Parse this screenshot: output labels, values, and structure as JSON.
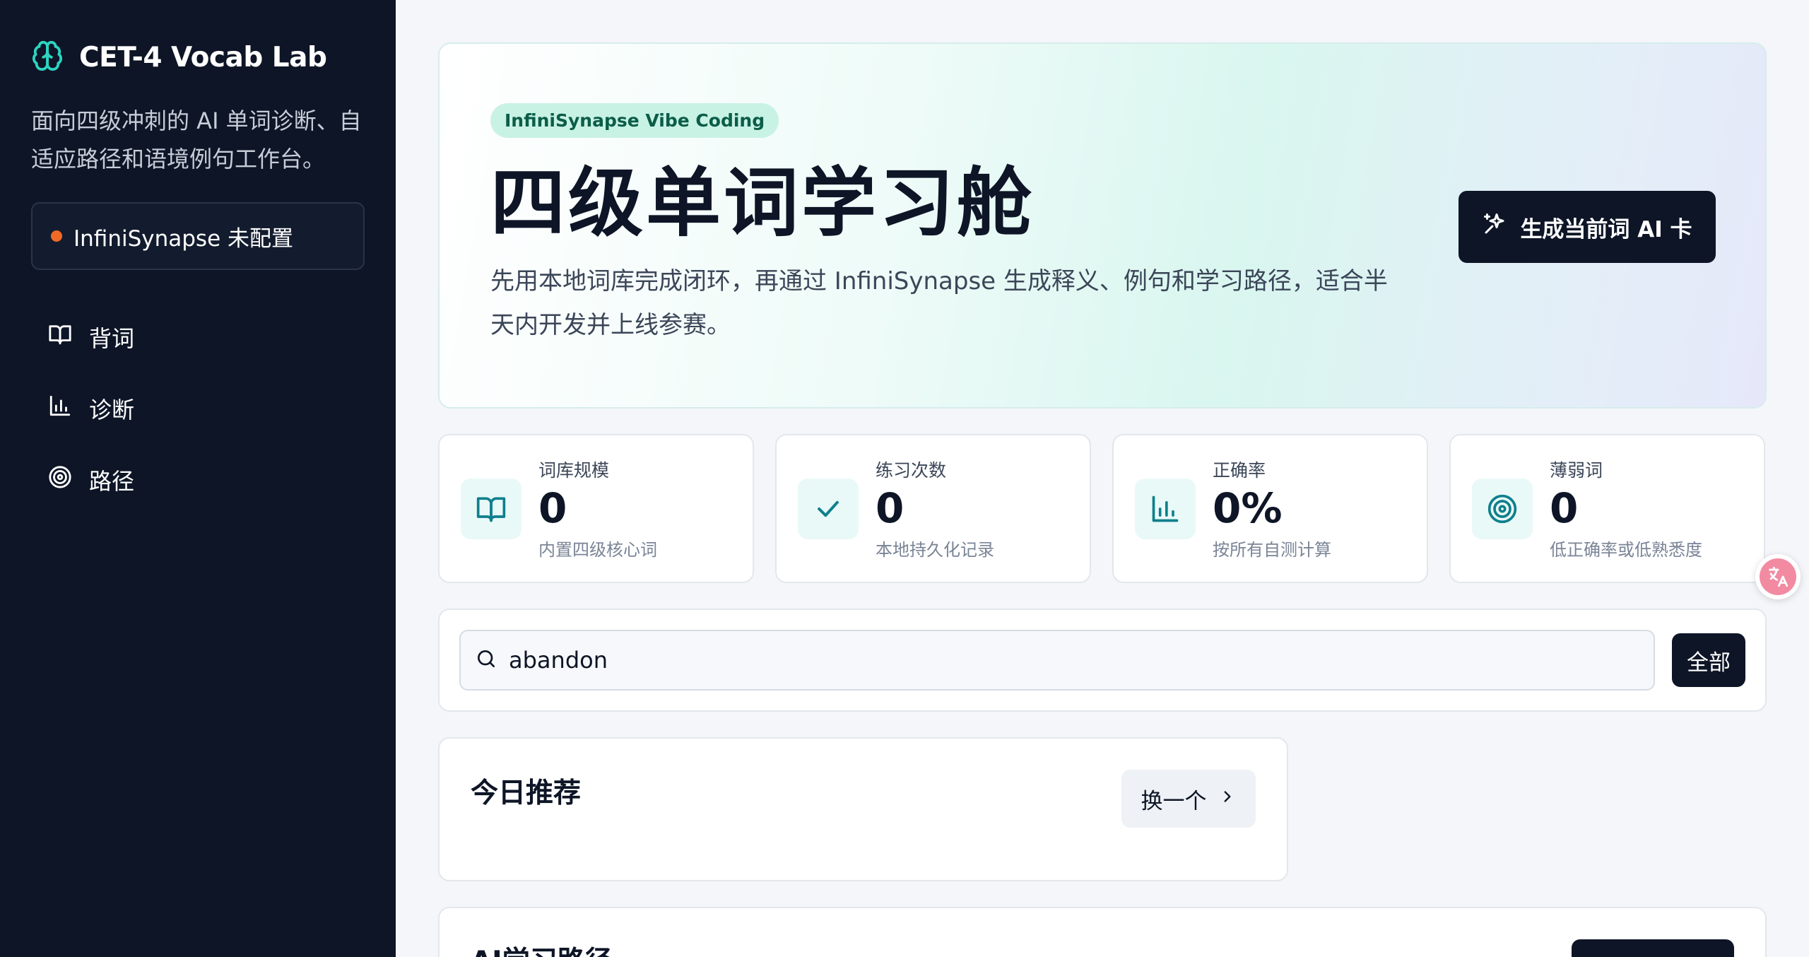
{
  "sidebar": {
    "brand_title": "CET-4 Vocab Lab",
    "brand_desc": "面向四级冲刺的 AI 单词诊断、自适应路径和语境例句工作台。",
    "status_text": "InfiniSynapse 未配置",
    "nav": [
      {
        "label": "背词",
        "icon": "book-icon"
      },
      {
        "label": "诊断",
        "icon": "bar-chart-icon"
      },
      {
        "label": "路径",
        "icon": "target-icon"
      }
    ]
  },
  "hero": {
    "pill": "InfiniSynapse Vibe Coding",
    "title": "四级单词学习舱",
    "desc": "先用本地词库完成闭环，再通过 InfiniSynapse 生成释义、例句和学习路径，适合半天内开发并上线参赛。",
    "button_label": "生成当前词 AI 卡"
  },
  "stats": [
    {
      "label": "词库规模",
      "value": "0",
      "note": "内置四级核心词",
      "icon": "book-icon"
    },
    {
      "label": "练习次数",
      "value": "0",
      "note": "本地持久化记录",
      "icon": "check-icon"
    },
    {
      "label": "正确率",
      "value": "0%",
      "note": "按所有自测计算",
      "icon": "bar-chart-icon"
    },
    {
      "label": "薄弱词",
      "value": "0",
      "note": "低正确率或低熟悉度",
      "icon": "target-icon"
    }
  ],
  "search": {
    "value": "abandon",
    "filter_label": "全部"
  },
  "recommend": {
    "title": "今日推荐",
    "button_label": "换一个"
  },
  "path": {
    "title": "AI学习路径"
  },
  "colors": {
    "sidebar_bg": "#0d1526",
    "accent": "#14b8a6",
    "status_dot": "#f06a26"
  }
}
